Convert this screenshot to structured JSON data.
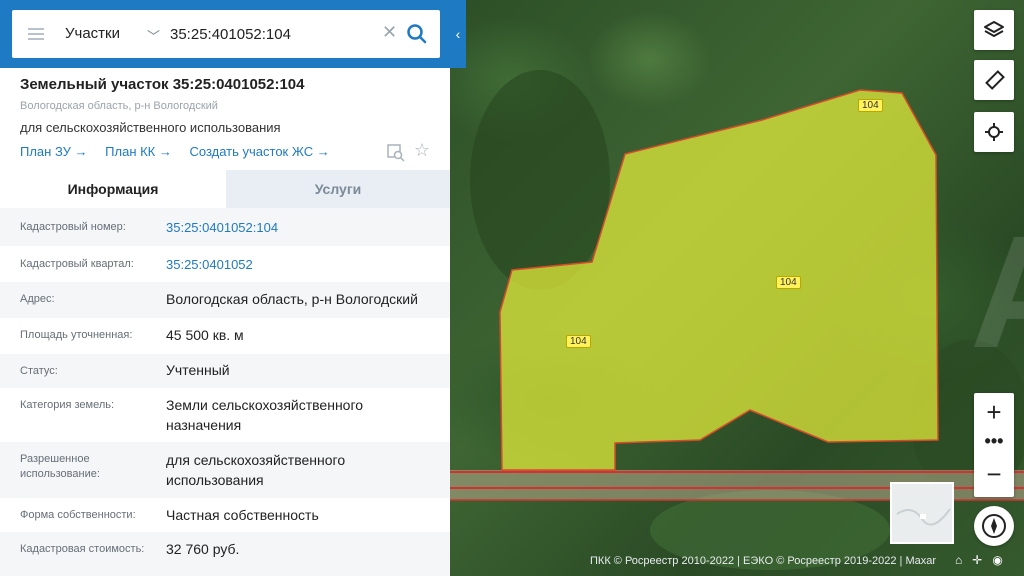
{
  "search": {
    "layer_select": "Участки",
    "query": "35:25:401052:104"
  },
  "plot": {
    "title": "Земельный участок 35:25:0401052:104",
    "region": "Вологодская область, р-н Вологодский",
    "use": "для сельскохозяйственного использования",
    "links": [
      "План ЗУ →",
      "План КК →",
      "Создать участок ЖС →"
    ]
  },
  "tabs": {
    "info": "Информация",
    "services": "Услуги"
  },
  "rows": [
    {
      "label": "Кадастровый номер:",
      "value": "35:25:0401052:104"
    },
    {
      "label": "Кадастровый квартал:",
      "value": "35:25:0401052"
    },
    {
      "label": "Адрес:",
      "value": "Вологодская область, р-н Вологодский"
    },
    {
      "label": "Площадь уточненная:",
      "value": "45 500 кв. м"
    },
    {
      "label": "Статус:",
      "value": "Учтенный"
    },
    {
      "label": "Категория земель:",
      "value": "Земли сельскохозяйственного назначения"
    },
    {
      "label": "Разрешенное использование:",
      "value": "для сельскохозяйственного использования"
    },
    {
      "label": "Форма собственности:",
      "value": "Частная собственность"
    },
    {
      "label": "Кадастровая стоимость:",
      "value": "32 760 руб."
    }
  ],
  "map": {
    "plot_labels": [
      "104",
      "104",
      "104"
    ],
    "watermark": "Avito",
    "attribution": "ПКК © Росреестр 2010-2022 | ЕЭКО © Росреестр 2019-2022 | Maxar",
    "colors": {
      "plot_fill": "#e6f03a",
      "plot_border": "#d94a2a",
      "accent": "#1f7ac4"
    }
  }
}
